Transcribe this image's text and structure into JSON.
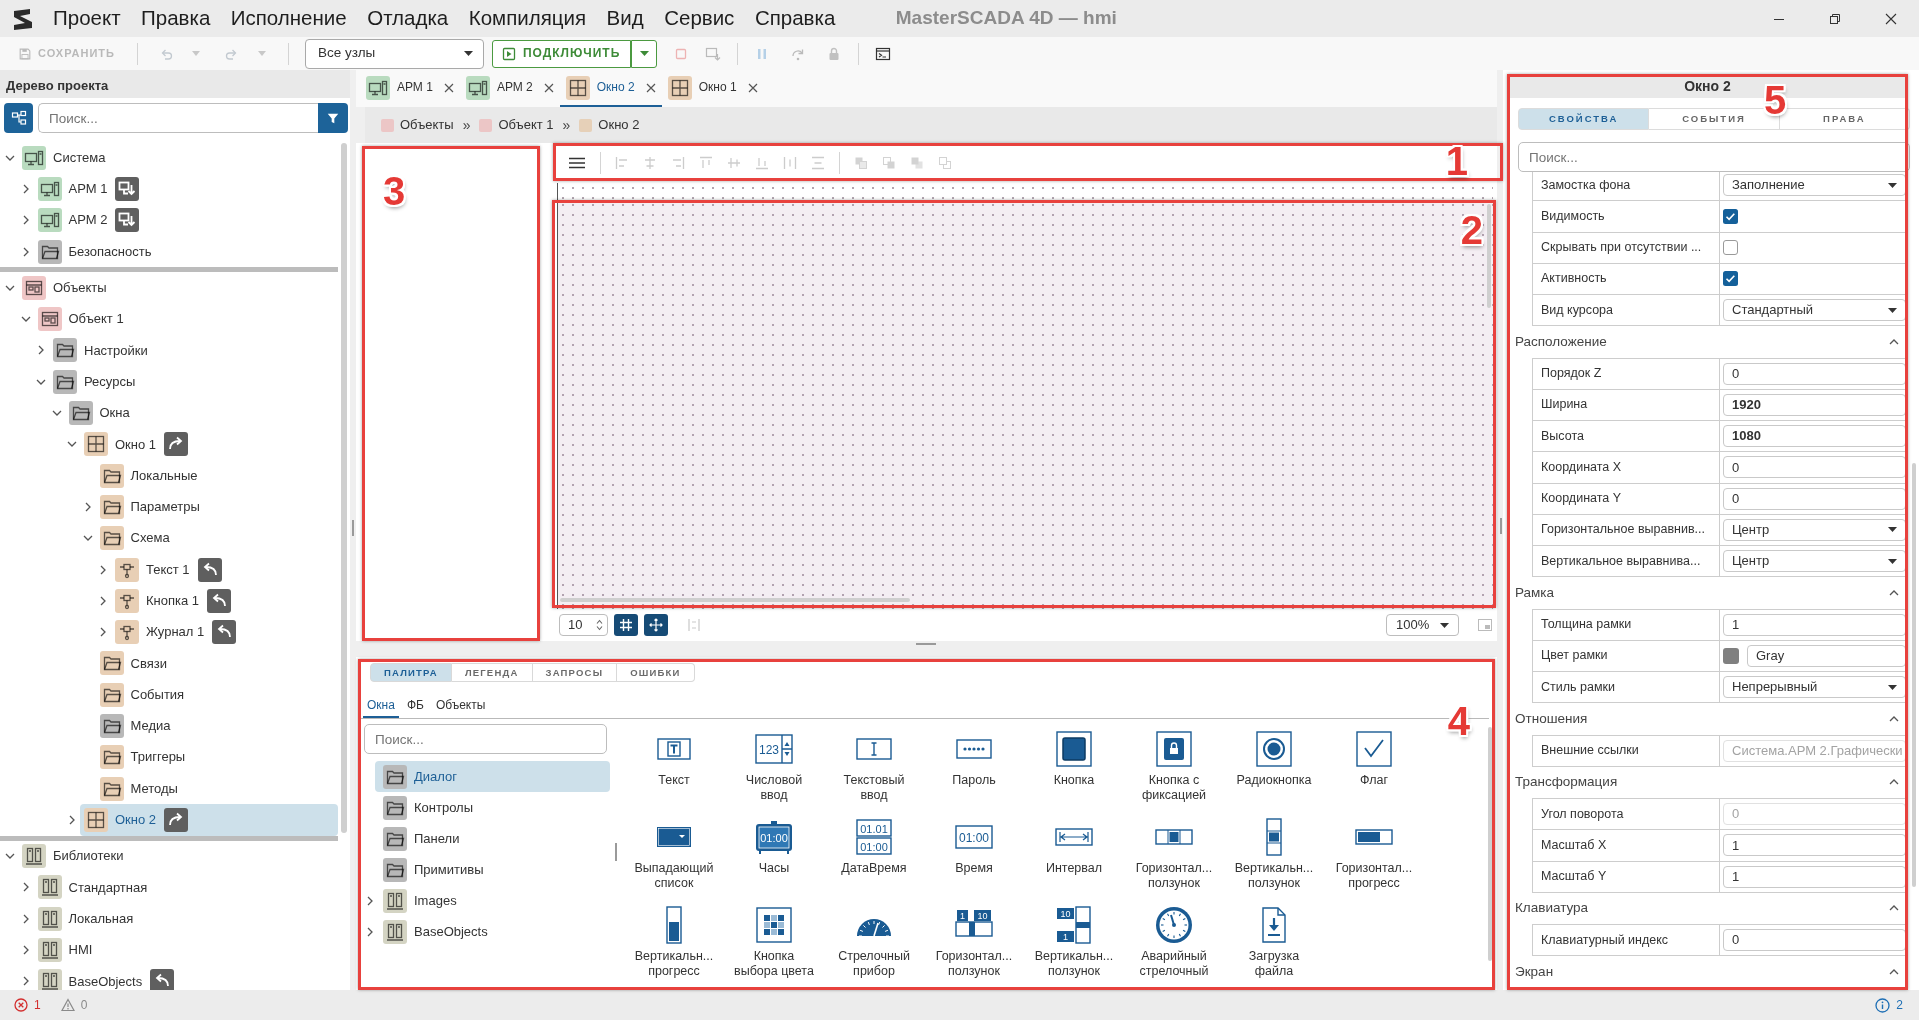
{
  "title_bar": {
    "menu": [
      "Проект",
      "Правка",
      "Исполнение",
      "Отладка",
      "Компиляция",
      "Вид",
      "Сервис",
      "Справка"
    ],
    "title": "MasterSCADA 4D — hmi"
  },
  "toolbar": [
    {
      "kind": "save",
      "label": "СОХРАНИТЬ",
      "disabled": true
    },
    {
      "kind": "separator"
    },
    {
      "kind": "undo",
      "disabled": true
    },
    {
      "kind": "redo",
      "disabled": true
    },
    {
      "kind": "separator"
    },
    {
      "kind": "node-select",
      "value": "Все узлы"
    },
    {
      "kind": "connect",
      "label": "ПОДКЛЮЧИТЬ",
      "disabled": false
    },
    {
      "kind": "stop",
      "disabled": true
    },
    {
      "kind": "deploy",
      "disabled": true
    },
    {
      "kind": "separator"
    },
    {
      "kind": "pause",
      "disabled": true
    },
    {
      "kind": "step",
      "disabled": true
    },
    {
      "kind": "lock",
      "disabled": true
    },
    {
      "kind": "separator"
    },
    {
      "kind": "terminal",
      "disabled": false
    }
  ],
  "project_tree": {
    "title": "Дерево проекта",
    "search": {
      "placeholder": "Поиск..."
    },
    "roots": [
      {
        "label": "Система",
        "kind": "station",
        "color": "#b9dbbf",
        "expanded": true,
        "selected": false,
        "children": [
          {
            "label": "АРМ 1",
            "kind": "station",
            "color": "#b9dbbf",
            "expanded": false,
            "selected": false,
            "badge": {
              "kind": "download"
            }
          },
          {
            "label": "АРМ 2",
            "kind": "station",
            "color": "#b9dbbf",
            "expanded": false,
            "selected": false,
            "badge": {
              "kind": "download"
            }
          },
          {
            "label": "Безопасность",
            "kind": "folder",
            "color": "#b8b8b8",
            "expanded": false,
            "selected": false
          }
        ]
      },
      {
        "label": "Объекты",
        "kind": "objects",
        "color": "#efc6c6",
        "expanded": true,
        "selected": false,
        "children": [
          {
            "label": "Объект 1",
            "kind": "objects",
            "color": "#efc6c6",
            "expanded": true,
            "selected": false,
            "children": [
              {
                "label": "Настройки",
                "kind": "folder",
                "color": "#b8b8b8",
                "expanded": false,
                "selected": false
              },
              {
                "label": "Ресурсы",
                "kind": "folder",
                "color": "#b8b8b8",
                "expanded": true,
                "selected": false,
                "children": [
                  {
                    "label": "Окна",
                    "kind": "folder",
                    "color": "#b8b8b8",
                    "expanded": true,
                    "selected": false,
                    "children": [
                      {
                        "label": "Окно 1",
                        "kind": "window",
                        "color": "#e8cfb5",
                        "expanded": true,
                        "selected": false,
                        "badge": {
                          "kind": "push"
                        },
                        "children": [
                          {
                            "label": "Локальные",
                            "kind": "folder",
                            "color": "#e8cfb5",
                            "selected": false
                          },
                          {
                            "label": "Параметры",
                            "kind": "folder",
                            "color": "#e8cfb5",
                            "expanded": false,
                            "selected": false
                          },
                          {
                            "label": "Схема",
                            "kind": "folder",
                            "color": "#e8cfb5",
                            "expanded": true,
                            "selected": false,
                            "children": [
                              {
                                "label": "Текст 1",
                                "kind": "component",
                                "color": "#e8cfb5",
                                "expanded": false,
                                "selected": false,
                                "badge": {
                                  "kind": "return"
                                }
                              },
                              {
                                "label": "Кнопка 1",
                                "kind": "component",
                                "color": "#e8cfb5",
                                "expanded": false,
                                "selected": false,
                                "badge": {
                                  "kind": "return"
                                }
                              },
                              {
                                "label": "Журнал 1",
                                "kind": "component",
                                "color": "#e8cfb5",
                                "expanded": false,
                                "selected": false,
                                "badge": {
                                  "kind": "return"
                                }
                              }
                            ]
                          },
                          {
                            "label": "Связи",
                            "kind": "folder",
                            "color": "#e8cfb5",
                            "selected": false
                          },
                          {
                            "label": "События",
                            "kind": "folder",
                            "color": "#e8cfb5",
                            "selected": false
                          },
                          {
                            "label": "Медиа",
                            "kind": "folder",
                            "color": "#b8b8b8",
                            "selected": false
                          },
                          {
                            "label": "Триггеры",
                            "kind": "folder",
                            "color": "#e8cfb5",
                            "selected": false
                          },
                          {
                            "label": "Методы",
                            "kind": "folder",
                            "color": "#e8cfb5",
                            "selected": false
                          }
                        ]
                      },
                      {
                        "label": "Окно 2",
                        "kind": "window",
                        "color": "#e8cfb5",
                        "expanded": false,
                        "selected": true,
                        "badge": {
                          "kind": "push"
                        }
                      }
                    ]
                  }
                ]
              }
            ]
          }
        ]
      },
      {
        "label": "Библиотеки",
        "kind": "library",
        "color": "#d4d4c3",
        "expanded": true,
        "selected": false,
        "children": [
          {
            "label": "Стандартная",
            "kind": "library",
            "color": "#d4d4c3",
            "expanded": false,
            "selected": false
          },
          {
            "label": "Локальная",
            "kind": "library",
            "color": "#d4d4c3",
            "expanded": false,
            "selected": false
          },
          {
            "label": "HMI",
            "kind": "library",
            "color": "#d4d4c3",
            "expanded": false,
            "selected": false
          },
          {
            "label": "BaseObjects",
            "kind": "library",
            "color": "#d4d4c3",
            "expanded": false,
            "selected": false,
            "badge": {
              "kind": "return"
            }
          }
        ]
      }
    ]
  },
  "document_tabs": [
    {
      "label": "АРМ 1",
      "kind": "station",
      "color": "#b9dbbf",
      "selected": false
    },
    {
      "label": "АРМ 2",
      "kind": "station",
      "color": "#b9dbbf",
      "selected": false
    },
    {
      "label": "Окно 2",
      "kind": "window",
      "color": "#e8cfb5",
      "selected": true
    },
    {
      "label": "Окно 1",
      "kind": "window",
      "color": "#e8cfb5",
      "selected": false
    }
  ],
  "breadcrumb": {
    "separator": "»",
    "items": [
      {
        "label": "Объекты",
        "color": "#ecc6c6"
      },
      {
        "label": "Объект 1",
        "color": "#ecc6c6"
      },
      {
        "label": "Окно 2",
        "color": "#e6d0b8"
      }
    ]
  },
  "structure_panel": {
    "callout": "3"
  },
  "designer_toolbar": {
    "callout": "1",
    "items": [
      {
        "kind": "menu",
        "disabled": false
      },
      {
        "kind": "separator"
      },
      {
        "kind": "align-left",
        "disabled": true
      },
      {
        "kind": "align-center",
        "disabled": true
      },
      {
        "kind": "align-right",
        "disabled": true
      },
      {
        "kind": "align-top",
        "disabled": true
      },
      {
        "kind": "align-middle",
        "disabled": true
      },
      {
        "kind": "align-bottom",
        "disabled": true
      },
      {
        "kind": "distribute-h",
        "disabled": true
      },
      {
        "kind": "distribute-v",
        "disabled": true
      },
      {
        "kind": "separator"
      },
      {
        "kind": "bring-front",
        "disabled": true
      },
      {
        "kind": "bring-forward",
        "disabled": true
      },
      {
        "kind": "send-backward",
        "disabled": true
      },
      {
        "kind": "send-back",
        "disabled": true
      }
    ]
  },
  "canvas": {
    "callout": "2"
  },
  "canvas_bar": {
    "grid_step": "10",
    "buttons": [
      {
        "kind": "grid",
        "on": true
      },
      {
        "kind": "snap",
        "on": true
      },
      {
        "kind": "guides",
        "on": false
      }
    ],
    "zoom": "100%"
  },
  "bottom_panel": {
    "callout": "4",
    "tabs": [
      {
        "label": "ПАЛИТРА",
        "selected": true
      },
      {
        "label": "ЛЕГЕНДА",
        "selected": false
      },
      {
        "label": "ЗАПРОСЫ",
        "selected": false
      },
      {
        "label": "ОШИБКИ",
        "selected": false
      }
    ],
    "subtabs": [
      {
        "label": "Окна",
        "selected": true
      },
      {
        "label": "ФБ",
        "selected": false
      },
      {
        "label": "Объекты",
        "selected": false
      }
    ],
    "search": {
      "placeholder": "Поиск..."
    },
    "categories": [
      {
        "label": "Диалог",
        "kind": "folder",
        "color": "#b8b8b8",
        "selected": true
      },
      {
        "label": "Контролы",
        "kind": "folder",
        "color": "#b8b8b8",
        "selected": false
      },
      {
        "label": "Панели",
        "kind": "folder",
        "color": "#b8b8b8",
        "selected": false
      },
      {
        "label": "Примитивы",
        "kind": "folder",
        "color": "#b8b8b8",
        "selected": false
      },
      {
        "label": "Images",
        "kind": "library",
        "color": "#d4d4c3",
        "expanded": false,
        "selected": false
      },
      {
        "label": "BaseObjects",
        "kind": "library",
        "color": "#d4d4c3",
        "expanded": false,
        "selected": false
      }
    ],
    "items": [
      {
        "label": "Текст",
        "kind": "text"
      },
      {
        "label": "Числовой\nввод",
        "kind": "numeric-input",
        "icon_text": [
          "123"
        ]
      },
      {
        "label": "Текстовый\nввод",
        "kind": "text-input"
      },
      {
        "label": "Пароль",
        "kind": "password"
      },
      {
        "label": "Кнопка",
        "kind": "button"
      },
      {
        "label": "Кнопка с\nфиксацией",
        "kind": "toggle-button"
      },
      {
        "label": "Радиокнопка",
        "kind": "radio"
      },
      {
        "label": "Флаг",
        "kind": "checkbox"
      },
      {
        "label": "Выпадающий\nсписок",
        "kind": "dropdown"
      },
      {
        "label": "Часы",
        "kind": "clock",
        "icon_text": [
          "01:00"
        ]
      },
      {
        "label": "ДатаВремя",
        "kind": "datetime",
        "icon_text": [
          "01.01",
          "01:00"
        ]
      },
      {
        "label": "Время",
        "kind": "time",
        "icon_text": [
          "01:00"
        ]
      },
      {
        "label": "Интервал",
        "kind": "interval"
      },
      {
        "label": "Горизонтал...\nползунок",
        "kind": "h-slider"
      },
      {
        "label": "Вертикальн...\nползунок",
        "kind": "v-slider"
      },
      {
        "label": "Горизонтал...\nпрогресс",
        "kind": "h-progress"
      },
      {
        "label": "Вертикальн...\nпрогресс",
        "kind": "v-progress"
      },
      {
        "label": "Кнопка\nвыбора цвета",
        "kind": "color-picker"
      },
      {
        "label": "Стрелочный\nприбор",
        "kind": "gauge"
      },
      {
        "label": "Горизонтал...\nползунок",
        "kind": "h-scale-slider",
        "icon_text": [
          "1",
          "10"
        ]
      },
      {
        "label": "Вертикальн...\nползунок",
        "kind": "v-scale-slider",
        "icon_text": [
          "10",
          "1"
        ]
      },
      {
        "label": "Аварийный\nстрелочный",
        "kind": "alarm-gauge"
      },
      {
        "label": "Загрузка\nфайла",
        "kind": "file-upload"
      }
    ]
  },
  "properties": {
    "callout": "5",
    "title": "Окно 2",
    "tabs": [
      {
        "label": "СВОЙСТВА",
        "selected": true
      },
      {
        "label": "СОБЫТИЯ",
        "selected": false
      },
      {
        "label": "ПРАВА",
        "selected": false
      }
    ],
    "search": {
      "placeholder": "Поиск..."
    },
    "rows": [
      {
        "label": "Замостка фона",
        "kind": "select",
        "value": "Заполнение"
      },
      {
        "label": "Видимость",
        "kind": "check",
        "checked": true
      },
      {
        "label": "Скрывать при отсутствии ...",
        "kind": "check",
        "checked": false
      },
      {
        "label": "Активность",
        "kind": "check",
        "checked": true
      },
      {
        "label": "Вид курсора",
        "kind": "select",
        "value": "Стандартный"
      }
    ],
    "groups": [
      {
        "title": "Расположение",
        "expanded": true,
        "rows": [
          {
            "label": "Порядок Z",
            "kind": "input",
            "value": "0",
            "changed": false,
            "disabled": false
          },
          {
            "label": "Ширина",
            "kind": "input",
            "value": "1920",
            "changed": true,
            "disabled": false
          },
          {
            "label": "Высота",
            "kind": "input",
            "value": "1080",
            "changed": true,
            "disabled": false
          },
          {
            "label": "Координата X",
            "kind": "input",
            "value": "0",
            "changed": false,
            "disabled": false
          },
          {
            "label": "Координата Y",
            "kind": "input",
            "value": "0",
            "changed": false,
            "disabled": false
          },
          {
            "label": "Горизонтальное выравнив...",
            "kind": "select",
            "value": "Центр"
          },
          {
            "label": "Вертикальное выравнива...",
            "kind": "select",
            "value": "Центр"
          }
        ]
      },
      {
        "title": "Рамка",
        "expanded": true,
        "rows": [
          {
            "label": "Толщина рамки",
            "kind": "input",
            "value": "1",
            "changed": false,
            "disabled": false
          },
          {
            "label": "Цвет рамки",
            "kind": "color",
            "color": "#808080",
            "value": "Gray"
          },
          {
            "label": "Стиль рамки",
            "kind": "select",
            "value": "Непрерывный"
          }
        ]
      },
      {
        "title": "Отношения",
        "expanded": true,
        "rows": [
          {
            "label": "Внешние ссылки",
            "kind": "input",
            "value": "Система.АРМ 2.Графически",
            "changed": false,
            "disabled": true
          }
        ]
      },
      {
        "title": "Трансформация",
        "expanded": true,
        "rows": [
          {
            "label": "Угол поворота",
            "kind": "input",
            "value": "0",
            "changed": false,
            "disabled": true
          },
          {
            "label": "Масштаб X",
            "kind": "input",
            "value": "1",
            "changed": false,
            "disabled": false
          },
          {
            "label": "Масштаб Y",
            "kind": "input",
            "value": "1",
            "changed": false,
            "disabled": false
          }
        ]
      },
      {
        "title": "Клавиатура",
        "expanded": true,
        "rows": [
          {
            "label": "Клавиатурный индекс",
            "kind": "input",
            "value": "0",
            "changed": false,
            "disabled": false
          }
        ]
      },
      {
        "title": "Экран",
        "expanded": true
      }
    ]
  },
  "status_bar": {
    "errors": "1",
    "warnings": "0",
    "messages": "2"
  }
}
